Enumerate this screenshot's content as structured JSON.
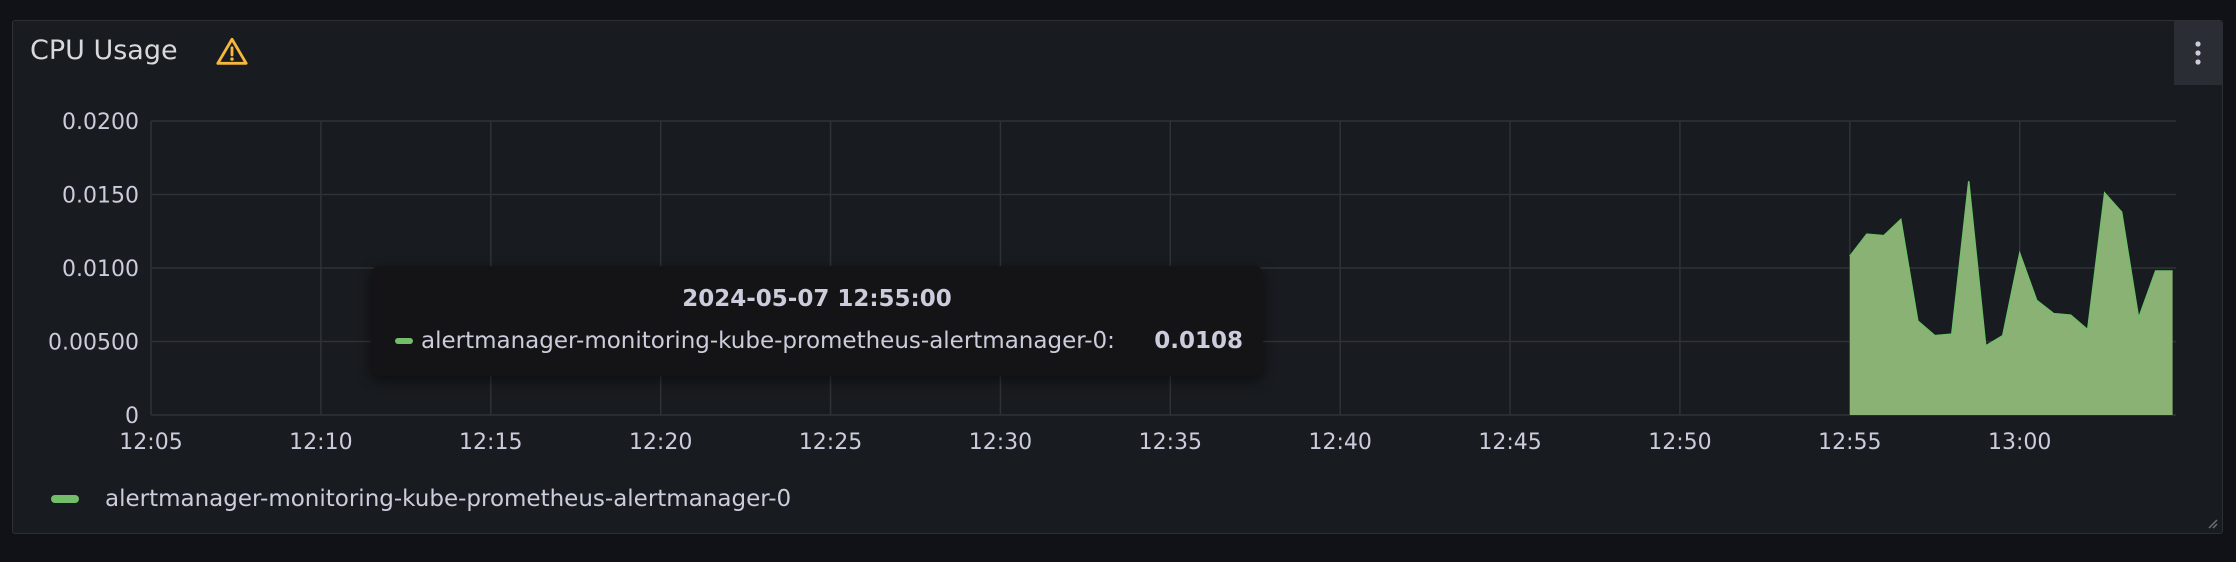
{
  "panel": {
    "title": "CPU Usage",
    "warning_icon": "warning-triangle-icon",
    "menu_icon": "kebab-menu-icon",
    "accent_color": "#73bf69",
    "warning_color": "#f5b73d"
  },
  "tooltip": {
    "time": "2024-05-07 12:55:00",
    "series_name": "alertmanager-monitoring-kube-prometheus-alertmanager-0:",
    "value": "0.0108"
  },
  "legend": {
    "items": [
      {
        "label": "alertmanager-monitoring-kube-prometheus-alertmanager-0",
        "color": "#73bf69"
      }
    ]
  },
  "chart_data": {
    "type": "area",
    "title": "CPU Usage",
    "xlabel": "",
    "ylabel": "",
    "grid": true,
    "legend_position": "bottom-left",
    "x_ticks": [
      "12:05",
      "12:10",
      "12:15",
      "12:20",
      "12:25",
      "12:30",
      "12:35",
      "12:40",
      "12:45",
      "12:50",
      "12:55",
      "13:00"
    ],
    "y_ticks": [
      "0",
      "0.00500",
      "0.0100",
      "0.0150",
      "0.0200"
    ],
    "xlim": [
      "12:05",
      "13:04.6"
    ],
    "ylim": [
      0,
      0.02
    ],
    "series": [
      {
        "name": "alertmanager-monitoring-kube-prometheus-alertmanager-0",
        "color": "#73bf69",
        "x": [
          "12:55:00",
          "12:55:30",
          "12:56:00",
          "12:56:30",
          "12:57:00",
          "12:57:30",
          "12:58:00",
          "12:58:30",
          "12:59:00",
          "12:59:30",
          "13:00:00",
          "13:00:30",
          "13:01:00",
          "13:01:30",
          "13:02:00",
          "13:02:30",
          "13:03:00",
          "13:03:30",
          "13:04:00",
          "13:04:30"
        ],
        "values": [
          0.0108,
          0.0123,
          0.0122,
          0.0133,
          0.0064,
          0.0054,
          0.0055,
          0.0159,
          0.0047,
          0.0054,
          0.011,
          0.0078,
          0.0069,
          0.0068,
          0.0058,
          0.0151,
          0.0138,
          0.0066,
          0.0098,
          0.0098
        ]
      }
    ]
  }
}
